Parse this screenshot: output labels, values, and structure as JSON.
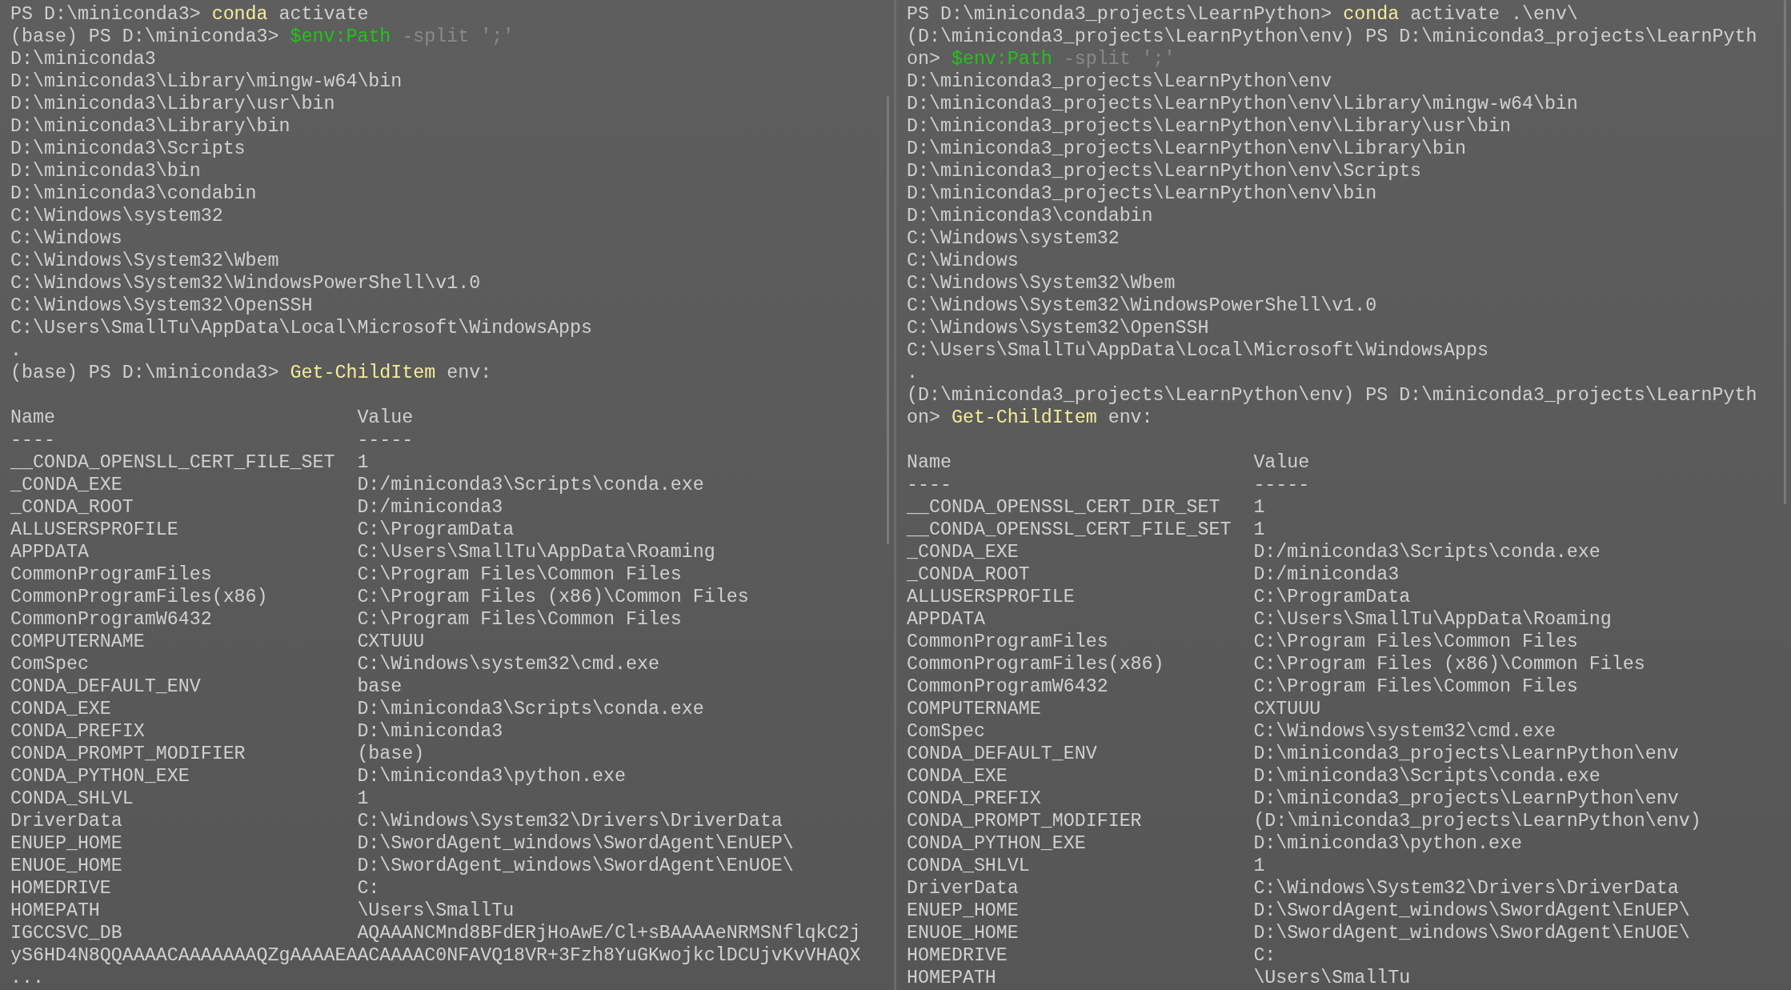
{
  "panes": [
    {
      "lines": [
        [
          {
            "kind": "text",
            "text": "PS D:\\miniconda3> "
          },
          {
            "kind": "command",
            "text": "conda"
          },
          {
            "kind": "text",
            "text": " activate"
          }
        ],
        [
          {
            "kind": "text",
            "text": "(base) PS D:\\miniconda3> "
          },
          {
            "kind": "variable",
            "text": "$env:Path"
          },
          {
            "kind": "parameter",
            "text": " -split ';'"
          }
        ],
        [
          {
            "kind": "text",
            "text": "D:\\miniconda3"
          }
        ],
        [
          {
            "kind": "text",
            "text": "D:\\miniconda3\\Library\\mingw-w64\\bin"
          }
        ],
        [
          {
            "kind": "text",
            "text": "D:\\miniconda3\\Library\\usr\\bin"
          }
        ],
        [
          {
            "kind": "text",
            "text": "D:\\miniconda3\\Library\\bin"
          }
        ],
        [
          {
            "kind": "text",
            "text": "D:\\miniconda3\\Scripts"
          }
        ],
        [
          {
            "kind": "text",
            "text": "D:\\miniconda3\\bin"
          }
        ],
        [
          {
            "kind": "text",
            "text": "D:\\miniconda3\\condabin"
          }
        ],
        [
          {
            "kind": "text",
            "text": "C:\\Windows\\system32"
          }
        ],
        [
          {
            "kind": "text",
            "text": "C:\\Windows"
          }
        ],
        [
          {
            "kind": "text",
            "text": "C:\\Windows\\System32\\Wbem"
          }
        ],
        [
          {
            "kind": "text",
            "text": "C:\\Windows\\System32\\WindowsPowerShell\\v1.0"
          }
        ],
        [
          {
            "kind": "text",
            "text": "C:\\Windows\\System32\\OpenSSH"
          }
        ],
        [
          {
            "kind": "text",
            "text": "C:\\Users\\SmallTu\\AppData\\Local\\Microsoft\\WindowsApps"
          }
        ],
        [
          {
            "kind": "text",
            "text": "."
          }
        ],
        [
          {
            "kind": "text",
            "text": "(base) PS D:\\miniconda3> "
          },
          {
            "kind": "command",
            "text": "Get-ChildItem"
          },
          {
            "kind": "text",
            "text": " env:"
          }
        ]
      ],
      "table": {
        "headers": [
          "Name",
          "Value"
        ],
        "rules": [
          "----",
          "-----"
        ],
        "rows": [
          {
            "name": "__CONDA_OPENSLL_CERT_FILE_SET",
            "value": "1"
          },
          {
            "name": "_CONDA_EXE",
            "value": "D:/miniconda3\\Scripts\\conda.exe"
          },
          {
            "name": "_CONDA_ROOT",
            "value": "D:/miniconda3"
          },
          {
            "name": "ALLUSERSPROFILE",
            "value": "C:\\ProgramData"
          },
          {
            "name": "APPDATA",
            "value": "C:\\Users\\SmallTu\\AppData\\Roaming"
          },
          {
            "name": "CommonProgramFiles",
            "value": "C:\\Program Files\\Common Files"
          },
          {
            "name": "CommonProgramFiles(x86)",
            "value": "C:\\Program Files (x86)\\Common Files"
          },
          {
            "name": "CommonProgramW6432",
            "value": "C:\\Program Files\\Common Files"
          },
          {
            "name": "COMPUTERNAME",
            "value": "CXTUUU"
          },
          {
            "name": "ComSpec",
            "value": "C:\\Windows\\system32\\cmd.exe"
          },
          {
            "name": "CONDA_DEFAULT_ENV",
            "value": "base"
          },
          {
            "name": "CONDA_EXE",
            "value": "D:\\miniconda3\\Scripts\\conda.exe"
          },
          {
            "name": "CONDA_PREFIX",
            "value": "D:\\miniconda3"
          },
          {
            "name": "CONDA_PROMPT_MODIFIER",
            "value": "(base)"
          },
          {
            "name": "CONDA_PYTHON_EXE",
            "value": "D:\\miniconda3\\python.exe"
          },
          {
            "name": "CONDA_SHLVL",
            "value": "1"
          },
          {
            "name": "DriverData",
            "value": "C:\\Windows\\System32\\Drivers\\DriverData"
          },
          {
            "name": "ENUEP_HOME",
            "value": "D:\\SwordAgent_windows\\SwordAgent\\EnUEP\\"
          },
          {
            "name": "ENUOE_HOME",
            "value": "D:\\SwordAgent_windows\\SwordAgent\\EnUOE\\"
          },
          {
            "name": "HOMEDRIVE",
            "value": "C:"
          },
          {
            "name": "HOMEPATH",
            "value": "\\Users\\SmallTu"
          },
          {
            "name": "IGCCSVC_DB",
            "value": "AQAAANCMnd8BFdERjHoAwE/Cl+sBAAAAeNRMSNflqkC2j"
          }
        ]
      },
      "lines_after": [
        [
          {
            "kind": "text",
            "text": "yS6HD4N8QQAAAACAAAAAAAQZgAAAAEAACAAAAC0NFAVQ18VR+3Fzh8YuGKwojkclDCUjvKvVHAQX"
          }
        ],
        [
          {
            "kind": "text",
            "text": "..."
          }
        ]
      ]
    },
    {
      "lines": [
        [
          {
            "kind": "text",
            "text": "PS D:\\miniconda3_projects\\LearnPython> "
          },
          {
            "kind": "command",
            "text": "conda"
          },
          {
            "kind": "text",
            "text": " activate .\\env\\"
          }
        ],
        [
          {
            "kind": "text",
            "text": "(D:\\miniconda3_projects\\LearnPython\\env) PS D:\\miniconda3_projects\\LearnPyth"
          }
        ],
        [
          {
            "kind": "text",
            "text": "on> "
          },
          {
            "kind": "variable",
            "text": "$env:Path"
          },
          {
            "kind": "parameter",
            "text": " -split ';'"
          }
        ],
        [
          {
            "kind": "text",
            "text": "D:\\miniconda3_projects\\LearnPython\\env"
          }
        ],
        [
          {
            "kind": "text",
            "text": "D:\\miniconda3_projects\\LearnPython\\env\\Library\\mingw-w64\\bin"
          }
        ],
        [
          {
            "kind": "text",
            "text": "D:\\miniconda3_projects\\LearnPython\\env\\Library\\usr\\bin"
          }
        ],
        [
          {
            "kind": "text",
            "text": "D:\\miniconda3_projects\\LearnPython\\env\\Library\\bin"
          }
        ],
        [
          {
            "kind": "text",
            "text": "D:\\miniconda3_projects\\LearnPython\\env\\Scripts"
          }
        ],
        [
          {
            "kind": "text",
            "text": "D:\\miniconda3_projects\\LearnPython\\env\\bin"
          }
        ],
        [
          {
            "kind": "text",
            "text": "D:\\miniconda3\\condabin"
          }
        ],
        [
          {
            "kind": "text",
            "text": "C:\\Windows\\system32"
          }
        ],
        [
          {
            "kind": "text",
            "text": "C:\\Windows"
          }
        ],
        [
          {
            "kind": "text",
            "text": "C:\\Windows\\System32\\Wbem"
          }
        ],
        [
          {
            "kind": "text",
            "text": "C:\\Windows\\System32\\WindowsPowerShell\\v1.0"
          }
        ],
        [
          {
            "kind": "text",
            "text": "C:\\Windows\\System32\\OpenSSH"
          }
        ],
        [
          {
            "kind": "text",
            "text": "C:\\Users\\SmallTu\\AppData\\Local\\Microsoft\\WindowsApps"
          }
        ],
        [
          {
            "kind": "text",
            "text": "."
          }
        ],
        [
          {
            "kind": "text",
            "text": "(D:\\miniconda3_projects\\LearnPython\\env) PS D:\\miniconda3_projects\\LearnPyth"
          }
        ],
        [
          {
            "kind": "text",
            "text": "on> "
          },
          {
            "kind": "command",
            "text": "Get-ChildItem"
          },
          {
            "kind": "text",
            "text": " env:"
          }
        ]
      ],
      "table": {
        "headers": [
          "Name",
          "Value"
        ],
        "rules": [
          "----",
          "-----"
        ],
        "rows": [
          {
            "name": "__CONDA_OPENSSL_CERT_DIR_SET",
            "value": "1"
          },
          {
            "name": "__CONDA_OPENSSL_CERT_FILE_SET",
            "value": "1"
          },
          {
            "name": "_CONDA_EXE",
            "value": "D:/miniconda3\\Scripts\\conda.exe"
          },
          {
            "name": "_CONDA_ROOT",
            "value": "D:/miniconda3"
          },
          {
            "name": "ALLUSERSPROFILE",
            "value": "C:\\ProgramData"
          },
          {
            "name": "APPDATA",
            "value": "C:\\Users\\SmallTu\\AppData\\Roaming"
          },
          {
            "name": "CommonProgramFiles",
            "value": "C:\\Program Files\\Common Files"
          },
          {
            "name": "CommonProgramFiles(x86)",
            "value": "C:\\Program Files (x86)\\Common Files"
          },
          {
            "name": "CommonProgramW6432",
            "value": "C:\\Program Files\\Common Files"
          },
          {
            "name": "COMPUTERNAME",
            "value": "CXTUUU"
          },
          {
            "name": "ComSpec",
            "value": "C:\\Windows\\system32\\cmd.exe"
          },
          {
            "name": "CONDA_DEFAULT_ENV",
            "value": "D:\\miniconda3_projects\\LearnPython\\env"
          },
          {
            "name": "CONDA_EXE",
            "value": "D:\\miniconda3\\Scripts\\conda.exe"
          },
          {
            "name": "CONDA_PREFIX",
            "value": "D:\\miniconda3_projects\\LearnPython\\env"
          },
          {
            "name": "CONDA_PROMPT_MODIFIER",
            "value": "(D:\\miniconda3_projects\\LearnPython\\env)"
          },
          {
            "name": "CONDA_PYTHON_EXE",
            "value": "D:\\miniconda3\\python.exe"
          },
          {
            "name": "CONDA_SHLVL",
            "value": "1"
          },
          {
            "name": "DriverData",
            "value": "C:\\Windows\\System32\\Drivers\\DriverData"
          },
          {
            "name": "ENUEP_HOME",
            "value": "D:\\SwordAgent_windows\\SwordAgent\\EnUEP\\"
          },
          {
            "name": "ENUOE_HOME",
            "value": "D:\\SwordAgent_windows\\SwordAgent\\EnUOE\\"
          },
          {
            "name": "HOMEDRIVE",
            "value": "C:"
          },
          {
            "name": "HOMEPATH",
            "value": "\\Users\\SmallTu"
          }
        ]
      }
    }
  ]
}
